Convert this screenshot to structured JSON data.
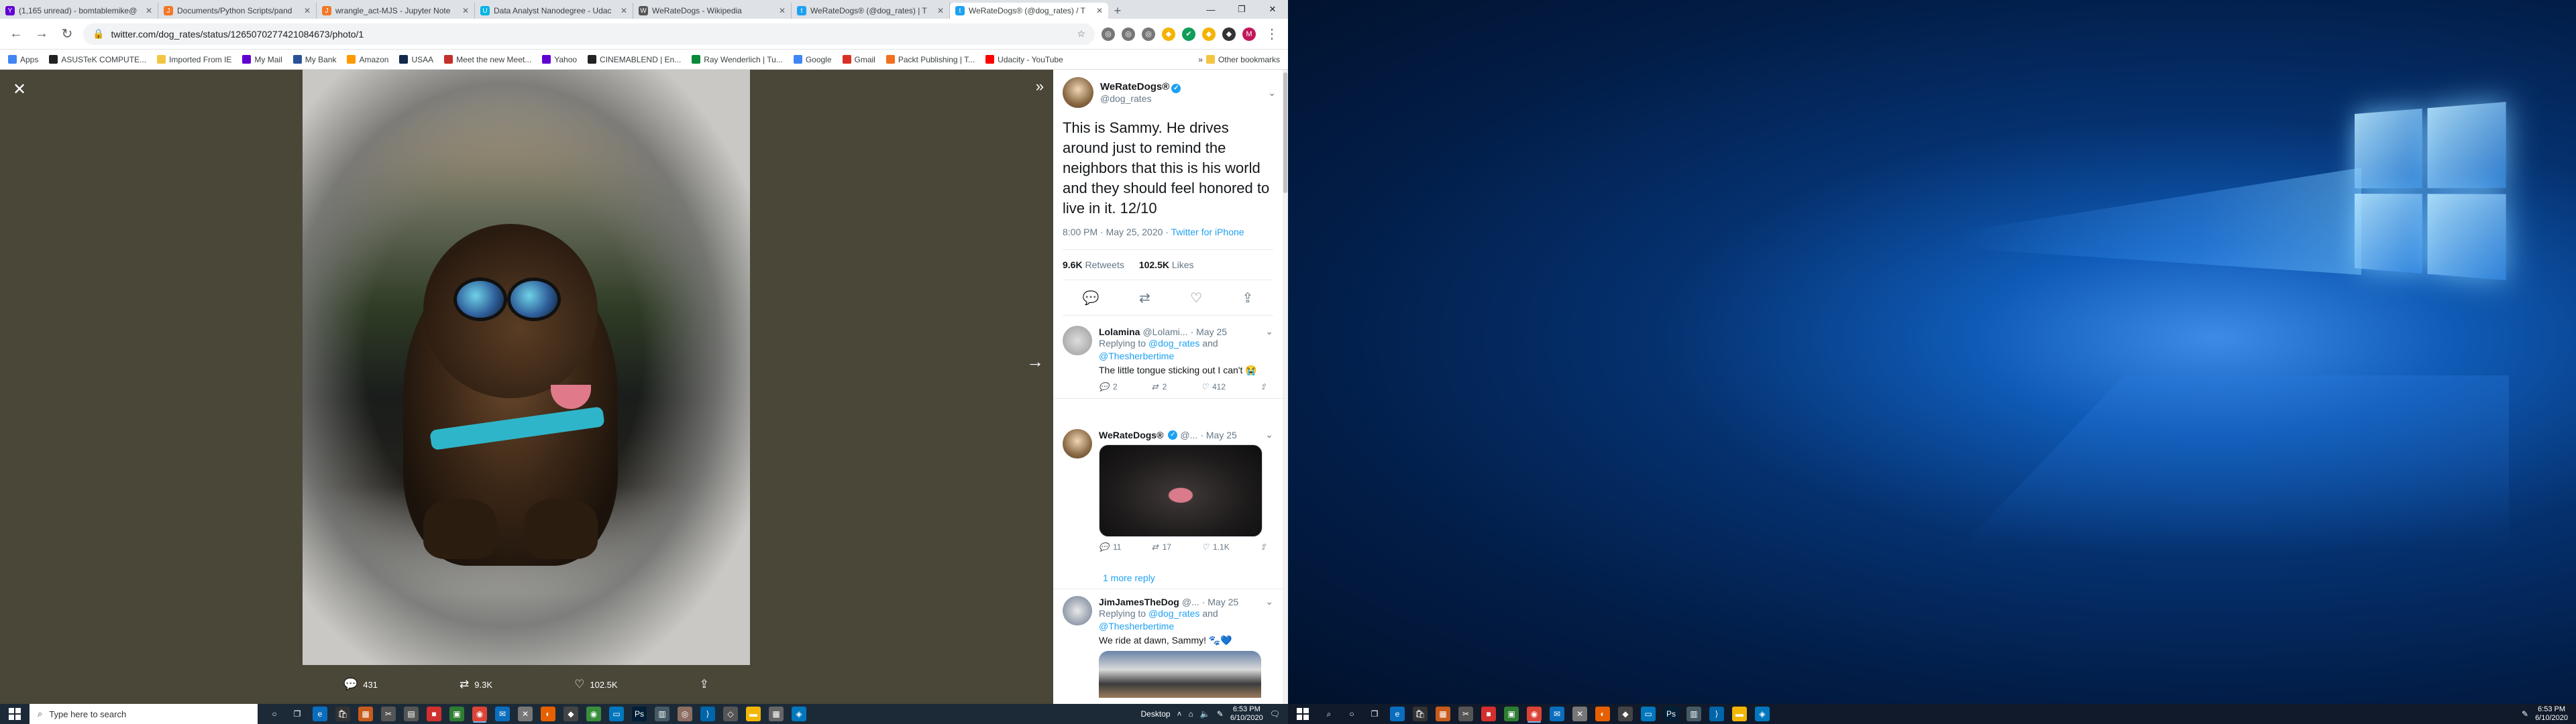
{
  "browser": {
    "tabs": [
      {
        "label": "(1,165 unread) - bomtablemike@",
        "color": "#6001d2",
        "icon": "Y"
      },
      {
        "label": "Documents/Python Scripts/pand",
        "color": "#f37726",
        "icon": "J"
      },
      {
        "label": "wrangle_act-MJS - Jupyter Note",
        "color": "#f37726",
        "icon": "J"
      },
      {
        "label": "Data Analyst Nanodegree - Udac",
        "color": "#02b3e4",
        "icon": "U"
      },
      {
        "label": "WeRateDogs - Wikipedia",
        "color": "#555555",
        "icon": "W"
      },
      {
        "label": "WeRateDogs® (@dog_rates) | T",
        "color": "#1da1f2",
        "icon": "t"
      },
      {
        "label": "WeRateDogs® (@dog_rates) / T",
        "color": "#1da1f2",
        "icon": "t"
      }
    ],
    "url": "twitter.com/dog_rates/status/1265070277421084673/photo/1",
    "bookmarks": [
      {
        "label": "Apps",
        "color": "#4285f4"
      },
      {
        "label": "ASUSTeK COMPUTE...",
        "color": "#222222"
      },
      {
        "label": "Imported From IE",
        "color": "#f4c542"
      },
      {
        "label": "My Mail",
        "color": "#6001d2"
      },
      {
        "label": "My Bank",
        "color": "#2a5298"
      },
      {
        "label": "Amazon",
        "color": "#ff9900"
      },
      {
        "label": "USAA",
        "color": "#12284c"
      },
      {
        "label": "Meet the new Meet...",
        "color": "#c4302b"
      },
      {
        "label": "Yahoo",
        "color": "#6001d2"
      },
      {
        "label": "CINEMABLEND | En...",
        "color": "#222222"
      },
      {
        "label": "Ray Wenderlich | Tu...",
        "color": "#0a8a3a"
      },
      {
        "label": "Google",
        "color": "#4285f4"
      },
      {
        "label": "Gmail",
        "color": "#d93025"
      },
      {
        "label": "Packt Publishing | T...",
        "color": "#f27021"
      },
      {
        "label": "Udacity - YouTube",
        "color": "#ff0000"
      }
    ],
    "other_bookmarks": "Other bookmarks"
  },
  "media": {
    "actions": {
      "replies": "431",
      "retweets": "9.3K",
      "likes": "102.5K"
    }
  },
  "tweet": {
    "name": "WeRateDogs®",
    "handle": "@dog_rates",
    "text": "This is Sammy. He drives around just to remind the neighbors that this is his world and they should feel honored to live in it. 12/10",
    "time": "8:00 PM · May 25, 2020 ·",
    "source": "Twitter for iPhone",
    "retweets_count": "9.6K",
    "retweets_label": "Retweets",
    "likes_count": "102.5K",
    "likes_label": "Likes"
  },
  "replies": [
    {
      "name": "Lolamina",
      "handle": "@Lolami...",
      "date": "· May 25",
      "replying_prefix": "Replying to",
      "replying_to_1": "@dog_rates",
      "replying_and": "and",
      "replying_to_2": "@Thesherbertime",
      "text": "The little tongue sticking out I can't 😭",
      "counts": {
        "reply": "2",
        "retweet": "2",
        "like": "412"
      }
    },
    {
      "name": "WeRateDogs®",
      "handle": "@...",
      "date": "· May 25",
      "counts": {
        "reply": "11",
        "retweet": "17",
        "like": "1.1K"
      }
    },
    {
      "name": "JimJamesTheDog",
      "handle": "@...",
      "date": "· May 25",
      "replying_prefix": "Replying to",
      "replying_to_1": "@dog_rates",
      "replying_and": "and",
      "replying_to_2": "@Thesherbertime",
      "text": "We ride at dawn, Sammy! 🐾💙"
    }
  ],
  "more_reply": "1 more reply",
  "taskbar_left": {
    "search_placeholder": "Type here to search",
    "desktop_label": "Desktop",
    "time": "6:53 PM",
    "date": "6/10/2020"
  },
  "taskbar_right": {
    "time": "6:53 PM",
    "date": "6/10/2020"
  }
}
